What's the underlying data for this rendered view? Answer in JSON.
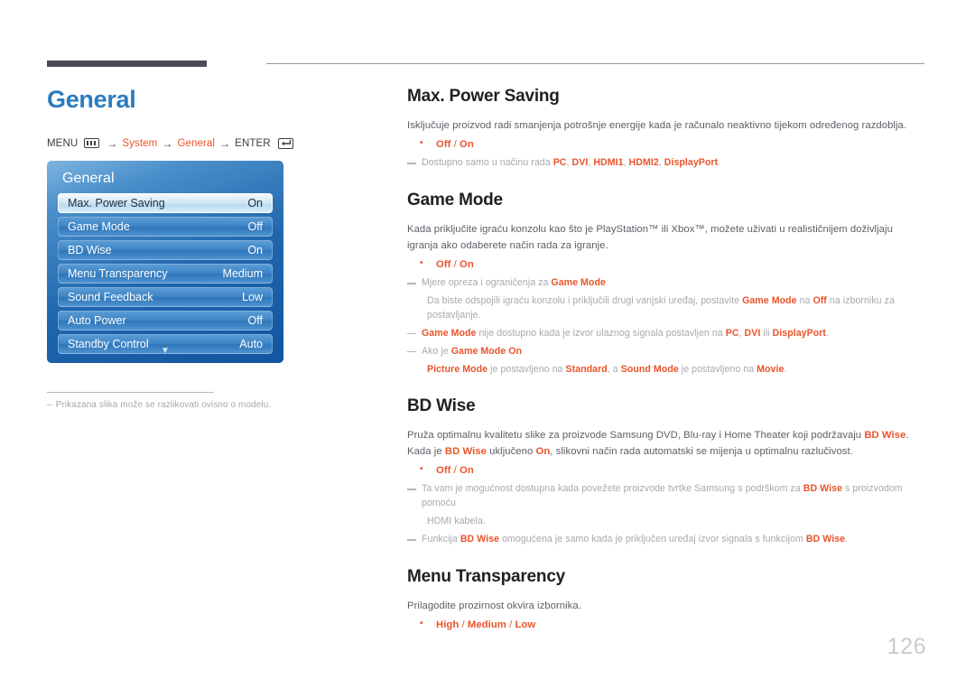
{
  "page": {
    "title": "General",
    "number": "126",
    "title_color": "#2c7cc0",
    "accent_color": "#e8542a"
  },
  "menu_path": {
    "menu_label": "MENU",
    "menu_icon": "menu-bars-icon",
    "arrow": "→",
    "step1": "System",
    "step2": "General",
    "enter_label": "ENTER",
    "enter_icon": "enter-return-icon"
  },
  "osd": {
    "title": "General",
    "rows": [
      {
        "label": "Max. Power Saving",
        "value": "On",
        "selected": true
      },
      {
        "label": "Game Mode",
        "value": "Off",
        "selected": false
      },
      {
        "label": "BD Wise",
        "value": "On",
        "selected": false
      },
      {
        "label": "Menu Transparency",
        "value": "Medium",
        "selected": false
      },
      {
        "label": "Sound Feedback",
        "value": "Low",
        "selected": false
      },
      {
        "label": "Auto Power",
        "value": "Off",
        "selected": false
      },
      {
        "label": "Standby Control",
        "value": "Auto",
        "selected": false
      }
    ],
    "scroll_icon": "chevron-down-icon",
    "footnote": "Prikazana slika može se razlikovati ovisno o modelu."
  },
  "sections": {
    "max_power_saving": {
      "title": "Max. Power Saving",
      "body": "Isključuje proizvod radi smanjenja potrošnje energije kada je računalo neaktivno tijekom određenog razdoblja.",
      "options_off": "Off",
      "options_sep": " / ",
      "options_on": "On",
      "note1_a": "Dostupno samo u načinu rada ",
      "note1_b": "PC",
      "note1_c": ", ",
      "note1_d": "DVI",
      "note1_e": ", ",
      "note1_f": "HDMI1",
      "note1_g": ", ",
      "note1_h": "HDMI2",
      "note1_i": ", ",
      "note1_j": "DisplayPort",
      "note1_k": "."
    },
    "game_mode": {
      "title": "Game Mode",
      "body": "Kada priključite igraću konzolu kao što je PlayStation™ ili Xbox™, možete uživati u realističnijem doživljaju igranja ako odaberete način rada za igranje.",
      "options_off": "Off",
      "options_sep": " / ",
      "options_on": "On",
      "note1_a": "Mjere opreza i ograničenja za ",
      "note1_b": "Game Mode",
      "note1_cont_a": "Da biste odspojili igraću konzolu i priključili drugi vanjski uređaj, postavite ",
      "note1_cont_b": "Game Mode",
      "note1_cont_c": " na ",
      "note1_cont_d": "Off",
      "note1_cont_e": " na izborniku za postavljanje.",
      "note2_a": "Game Mode",
      "note2_b": " nije dostupno kada je izvor ulaznog signala postavljen na ",
      "note2_c": "PC",
      "note2_d": ", ",
      "note2_e": "DVI",
      "note2_f": " ili ",
      "note2_g": "DisplayPort",
      "note2_h": ".",
      "note3_a": "Ako je ",
      "note3_b": "Game Mode On",
      "note3_cont_a": "Picture Mode",
      "note3_cont_b": " je postavljeno na ",
      "note3_cont_c": "Standard",
      "note3_cont_d": ", a ",
      "note3_cont_e": "Sound Mode",
      "note3_cont_f": " je postavljeno na ",
      "note3_cont_g": "Movie",
      "note3_cont_h": "."
    },
    "bd_wise": {
      "title": "BD Wise",
      "body_a": "Pruža optimalnu kvalitetu slike za proizvode Samsung DVD, Blu-ray i Home Theater koji podržavaju ",
      "body_b": "BD Wise",
      "body_c": ". Kada je ",
      "body_d": "BD Wise",
      "body_e": " uključeno ",
      "body_f": "On",
      "body_g": ", slikovni način rada automatski se mijenja u optimalnu razlučivost.",
      "options_off": "Off",
      "options_sep": " / ",
      "options_on": "On",
      "note1_a": "Ta vam je mogućnost dostupna kada povežete proizvode tvrtke Samsung s podrškom za ",
      "note1_b": "BD Wise",
      "note1_c": " s proizvodom pomoću",
      "note1_cont": "HDMI kabela.",
      "note2_a": "Funkcija ",
      "note2_b": "BD Wise",
      "note2_c": " omogućena je samo kada je priključen uređaj izvor signala s funkcijom ",
      "note2_d": "BD Wise",
      "note2_e": "."
    },
    "menu_transparency": {
      "title": "Menu Transparency",
      "body": "Prilagodite prozirnost okvira izbornika.",
      "options_high": "High",
      "options_sep1": " / ",
      "options_medium": "Medium",
      "options_sep2": " / ",
      "options_low": "Low"
    }
  }
}
